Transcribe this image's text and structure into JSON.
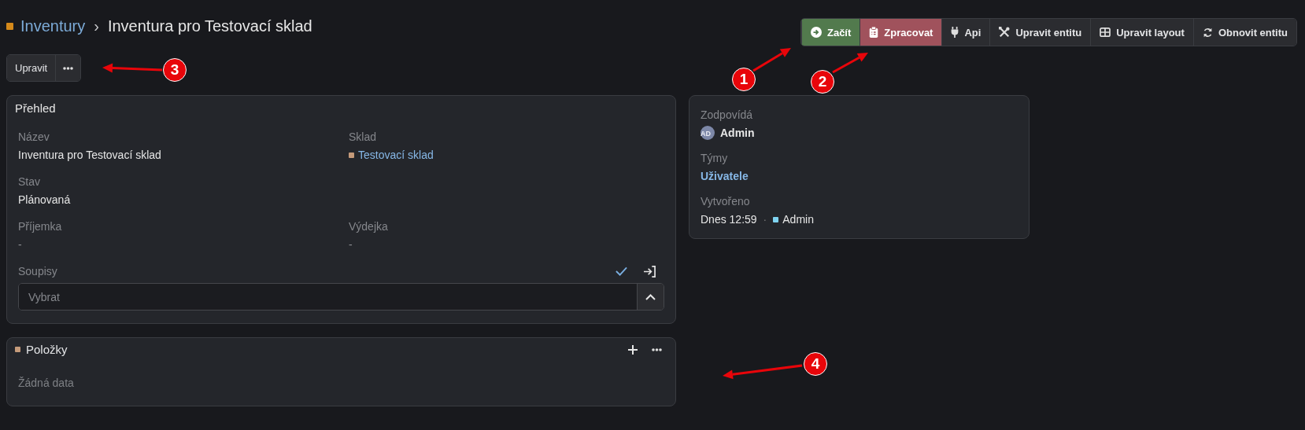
{
  "breadcrumb": {
    "parent": "Inventury",
    "separator": "›",
    "title": "Inventura pro Testovací sklad"
  },
  "actions": [
    {
      "label": "Začít",
      "kind": "success"
    },
    {
      "label": "Zpracovat",
      "kind": "danger"
    },
    {
      "label": "Api",
      "kind": "default"
    },
    {
      "label": "Upravit entitu",
      "kind": "default"
    },
    {
      "label": "Upravit layout",
      "kind": "default"
    },
    {
      "label": "Obnovit entitu",
      "kind": "default"
    }
  ],
  "edit_button": {
    "label": "Upravit"
  },
  "overview": {
    "title": "Přehled",
    "rows": [
      [
        {
          "label": "Název",
          "value": "Inventura pro Testovací sklad",
          "kind": "text"
        },
        {
          "label": "Sklad",
          "value": "Testovací sklad",
          "kind": "link"
        }
      ],
      [
        {
          "label": "Stav",
          "value": "Plánovaná",
          "kind": "text"
        }
      ],
      [
        {
          "label": "Příjemka",
          "value": "-",
          "kind": "empty"
        },
        {
          "label": "Výdejka",
          "value": "-",
          "kind": "empty"
        }
      ]
    ],
    "lookup": {
      "label": "Soupisy",
      "placeholder": "Vybrat"
    }
  },
  "side": {
    "fields": [
      {
        "label": "Zodpovídá",
        "kind": "user",
        "avatar": "AD",
        "value": "Admin"
      },
      {
        "label": "Týmy",
        "kind": "link",
        "value": "Uživatele"
      },
      {
        "label": "Vytvořeno",
        "kind": "created",
        "value": "Dnes 12:59",
        "separator": "·",
        "user": "Admin"
      }
    ]
  },
  "items_panel": {
    "title": "Položky",
    "empty_text": "Žádná data"
  },
  "annotations": [
    {
      "number": "1"
    },
    {
      "number": "2"
    },
    {
      "number": "3"
    },
    {
      "number": "4"
    }
  ]
}
